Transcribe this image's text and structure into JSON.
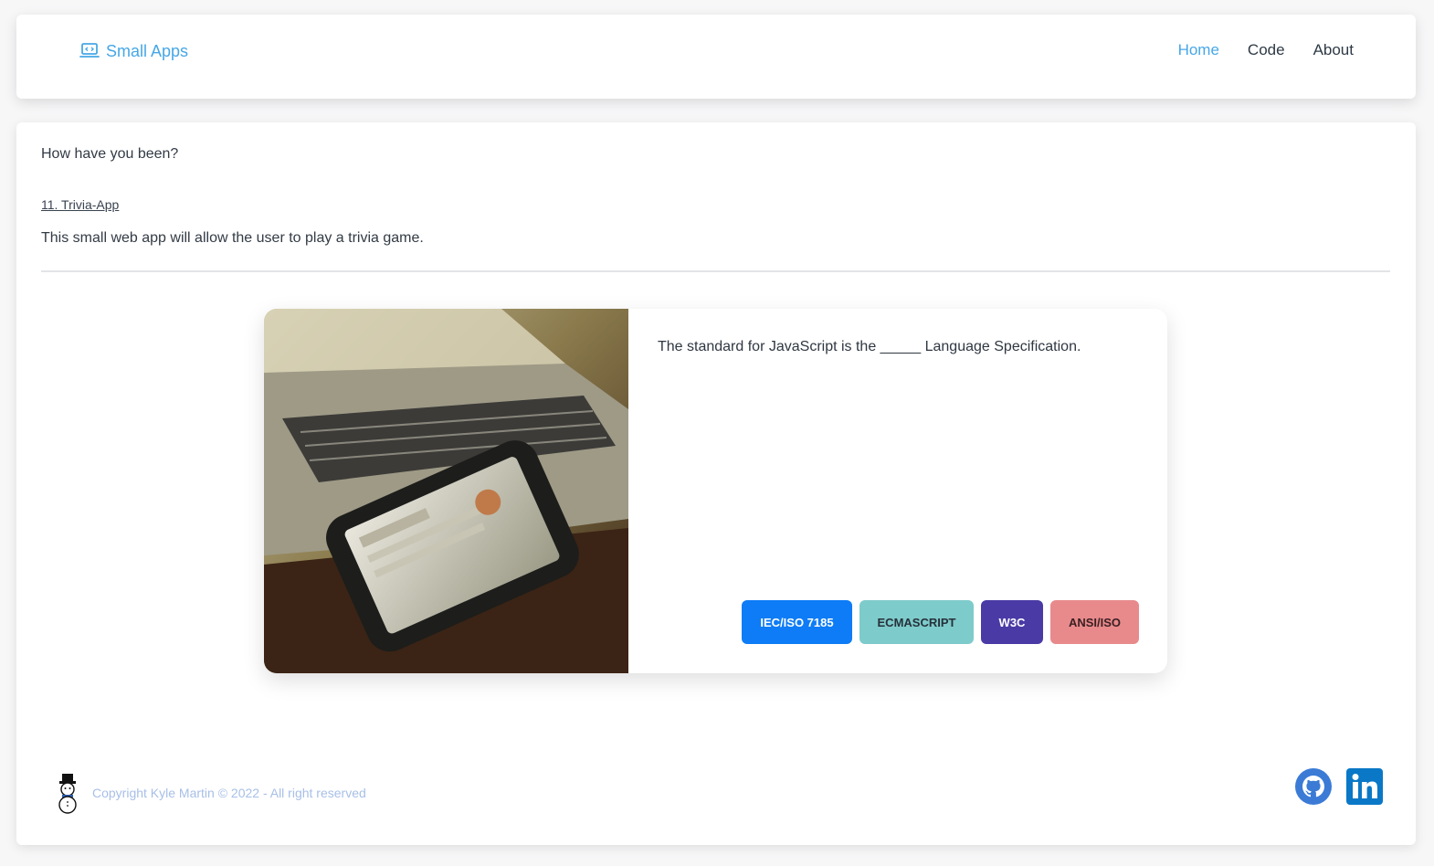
{
  "nav": {
    "brand": "Small Apps",
    "links": [
      {
        "label": "Home",
        "active": true
      },
      {
        "label": "Code",
        "active": false
      },
      {
        "label": "About",
        "active": false
      }
    ]
  },
  "main": {
    "greeting": "How have you been?",
    "app_link": "11. Trivia-App",
    "app_description": "This small web app will allow the user to play a trivia game."
  },
  "trivia": {
    "question": "The standard for JavaScript is the _____ Language Specification.",
    "answers": [
      {
        "label": "IEC/ISO 7185",
        "color": "#0d7cf6"
      },
      {
        "label": "ECMASCRIPT",
        "color": "#7ecbcb"
      },
      {
        "label": "W3C",
        "color": "#4a3aa6"
      },
      {
        "label": "ANSI/ISO",
        "color": "#e88a8c"
      }
    ]
  },
  "footer": {
    "copyright": "Copyright Kyle Martin © 2022 - All right reserved",
    "icons": [
      "snowman-logo-icon",
      "github-icon",
      "linkedin-icon"
    ]
  },
  "colors": {
    "accent": "#47a7e6",
    "footer_text": "#a7bfe7",
    "github": "#3b7bd6",
    "linkedin": "#0a78c6"
  }
}
